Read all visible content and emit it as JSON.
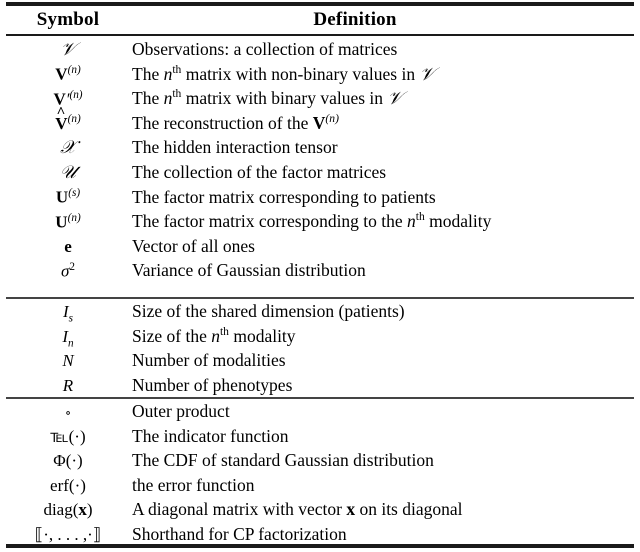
{
  "table": {
    "caption_absent": true,
    "columns": [
      {
        "key": "symbol",
        "label": "Symbol"
      },
      {
        "key": "definition",
        "label": "Definition"
      }
    ],
    "rule_color": "#1a1a1a",
    "groups": [
      {
        "id": "group-tensors",
        "rows": [
          {
            "symbol_text": "ᵋ1",
            "definition": "Observations: a collection of matrices"
          },
          {
            "symbol_text": "V(n)",
            "definition": "The n^th matrix with non-binary values in ᵋ1"
          },
          {
            "symbol_text": "V'(n)",
            "definition": "The n^th matrix with binary values in ᵋ1"
          },
          {
            "symbol_text": "V̂(n)",
            "definition": "The reconstruction of the V(n)"
          },
          {
            "symbol_text": "ᵋ3",
            "definition": "The hidden interaction tensor"
          },
          {
            "symbol_text": "ᵋ0",
            "definition": "The collection of the factor matrices"
          },
          {
            "symbol_text": "U(s)",
            "definition": "The factor matrix corresponding to patients"
          },
          {
            "symbol_text": "U(n)",
            "definition": "The factor matrix corresponding to the n^th modality"
          },
          {
            "symbol_text": "e",
            "definition": "Vector of all ones"
          },
          {
            "symbol_text": "sigma^2",
            "definition": "Variance of Gaussian distribution"
          }
        ]
      },
      {
        "id": "group-dimensions",
        "rows": [
          {
            "symbol_text": "I_s",
            "definition": "Size of the shared dimension (patients)"
          },
          {
            "symbol_text": "I_n",
            "definition": "Size of the n^th modality"
          },
          {
            "symbol_text": "N",
            "definition": "Number of modalities"
          },
          {
            "symbol_text": "R",
            "definition": "Number of phenotypes"
          }
        ]
      },
      {
        "id": "group-operators",
        "rows": [
          {
            "symbol_text": "∘",
            "definition": "Outer product"
          },
          {
            "symbol_text": "1(·)",
            "definition": "The indicator function"
          },
          {
            "symbol_text": "Φ(·)",
            "definition": "The CDF of standard Gaussian distribution"
          },
          {
            "symbol_text": "erf(·)",
            "definition": "the error function"
          },
          {
            "symbol_text": "diag(x)",
            "definition": "A diagonal matrix with vector x on its diagonal"
          },
          {
            "symbol_text": "[[·, . . . , ·]]",
            "definition": "Shorthand for CP factorization"
          }
        ]
      }
    ],
    "definitions": {
      "d0": "Observations: a collection of matrices",
      "d1_a": "The ",
      "d1_b": " matrix with non-binary values in ",
      "d2_a": "The ",
      "d2_b": " matrix with binary values in ",
      "d3_a": "The reconstruction of the ",
      "d4": "The hidden interaction tensor",
      "d5": "The collection of the factor matrices",
      "d6": "The factor matrix corresponding to patients",
      "d7_a": "The factor matrix corresponding to the ",
      "d7_b": " modality",
      "d8": "Vector of all ones",
      "d9": "Variance of Gaussian distribution",
      "d10": "Size of the shared dimension (patients)",
      "d11_a": "Size of the ",
      "d11_b": " modality",
      "d12": "Number of modalities",
      "d13": "Number of phenotypes",
      "d14": "Outer product",
      "d15": "The indicator function",
      "d16": "The CDF of standard Gaussian distribution",
      "d17": "the error function",
      "d18_a": "A diagonal matrix with vector ",
      "d18_b": " on its diagonal",
      "d19": "Shorthand for CP factorization"
    },
    "glyphs": {
      "script_v": "𝒱",
      "script_x": "𝒳",
      "script_u": "𝒰",
      "bold_v": "V",
      "bold_u": "U",
      "bold_e": "e",
      "bold_x": "x",
      "sigma": "σ",
      "phi": "Φ",
      "italic_i": "I",
      "italic_n": "N",
      "italic_r": "R",
      "ring_operator": "∘",
      "indicator_one": "℡",
      "erf": "erf",
      "diag": "diag",
      "cp_open": "⟦",
      "cp_close": "⟧",
      "cdot": "·",
      "ellipsis_dots": ", . . . ,",
      "sup_n": "n",
      "sup_th": "th",
      "sup_s": "s",
      "sup_two": "2",
      "prime": "′",
      "paren_open": "(",
      "paren_close": ")"
    }
  }
}
